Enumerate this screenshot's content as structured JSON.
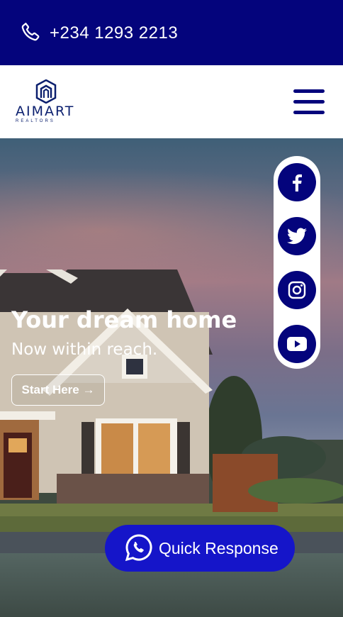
{
  "topbar": {
    "phone": "+234 1293 2213",
    "icon": "phone-icon",
    "bg_color": "#04047c"
  },
  "header": {
    "logo_text": "AIMART",
    "logo_subtext": "REALTORS",
    "menu_icon": "hamburger-menu-icon"
  },
  "hero": {
    "title": "Your dream home",
    "subtitle": "Now within reach.",
    "cta_label": "Start Here →"
  },
  "social": {
    "items": [
      "facebook-icon",
      "twitter-icon",
      "instagram-icon",
      "youtube-icon"
    ]
  },
  "quick_response": {
    "label": "Quick Response",
    "icon": "whatsapp-icon",
    "color": "#1515c9"
  }
}
